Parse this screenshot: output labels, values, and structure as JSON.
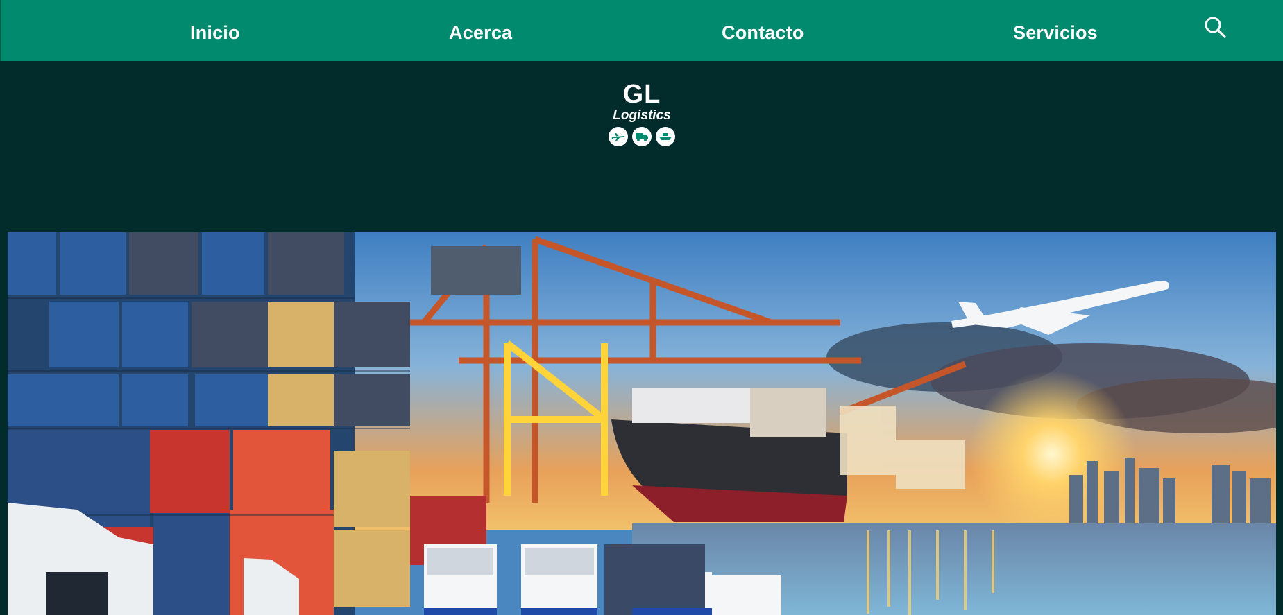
{
  "nav": {
    "items": [
      {
        "label": "Inicio"
      },
      {
        "label": "Acerca"
      },
      {
        "label": "Contacto"
      },
      {
        "label": "Servicios"
      }
    ],
    "search_icon": "search-icon"
  },
  "logo": {
    "mark": "GL",
    "subtitle": "Logistics",
    "icons": [
      "airplane-icon",
      "truck-icon",
      "ship-icon"
    ]
  },
  "hero": {
    "image": "port-logistics-photo",
    "subject": "cargo port with shipping containers, cranes, cargo ship, trucks and airplane at sunset"
  },
  "colors": {
    "topbar": "#028a6f",
    "header_band": "#022b2b",
    "text": "#ffffff"
  }
}
